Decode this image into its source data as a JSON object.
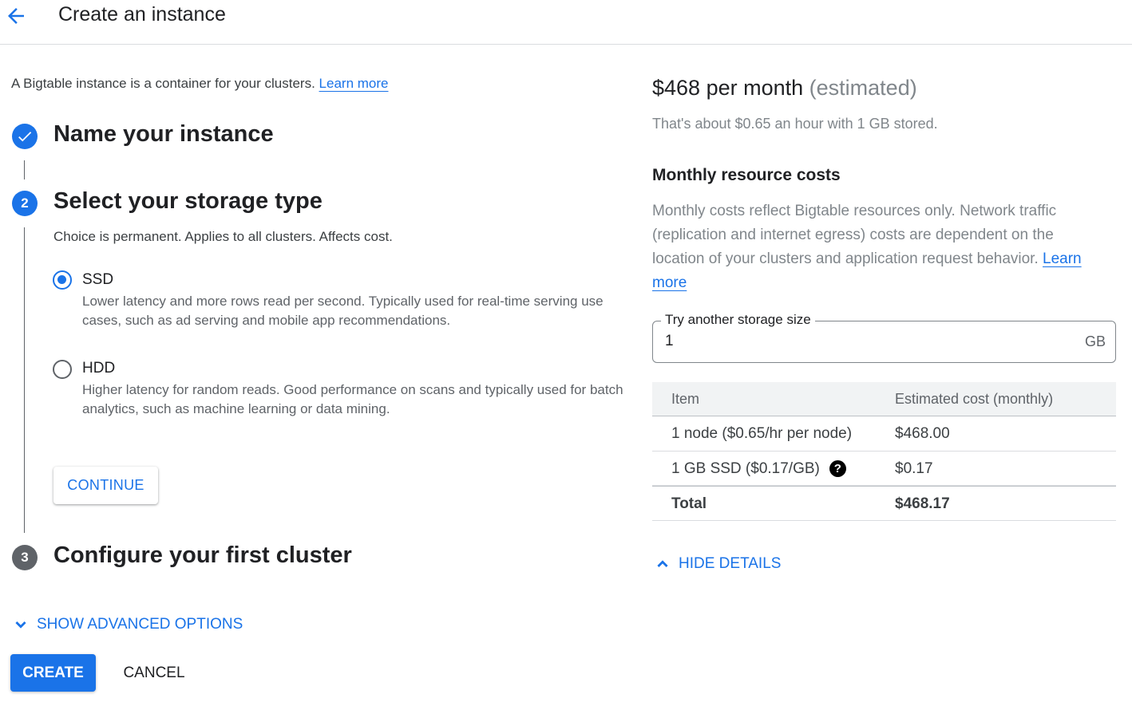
{
  "header": {
    "back_icon": "arrow-back-icon",
    "title": "Create an instance"
  },
  "intro": {
    "text": "A Bigtable instance is a container for your clusters.",
    "learn_more": "Learn more"
  },
  "steps": [
    {
      "number": "",
      "icon": "check-icon",
      "title": "Name your instance",
      "status": "done"
    },
    {
      "number": "2",
      "title": "Select your storage type",
      "status": "active",
      "description": "Choice is permanent. Applies to all clusters. Affects cost."
    },
    {
      "number": "3",
      "title": "Configure your first cluster",
      "status": "pending"
    }
  ],
  "storage_options": [
    {
      "label": "SSD",
      "selected": true,
      "description": "Lower latency and more rows read per second. Typically used for real-time serving use cases, such as ad serving and mobile app recommendations."
    },
    {
      "label": "HDD",
      "selected": false,
      "description": "Higher latency for random reads. Good performance on scans and typically used for batch analytics, such as machine learning or data mining."
    }
  ],
  "buttons": {
    "continue": "CONTINUE",
    "show_advanced": "SHOW ADVANCED OPTIONS",
    "create": "CREATE",
    "cancel": "CANCEL",
    "hide_details": "HIDE DETAILS"
  },
  "pricing": {
    "monthly": "$468 per month",
    "estimated": "(estimated)",
    "hourly_note": "That's about $0.65 an hour with 1 GB stored.",
    "costs_heading": "Monthly resource costs",
    "costs_description": "Monthly costs reflect Bigtable resources only. Network traffic (replication and internet egress) costs are dependent on the location of your clusters and application request behavior.",
    "learn_more": "Learn more",
    "storage_size": {
      "label": "Try another storage size",
      "value": "1",
      "unit": "GB"
    },
    "table": {
      "headers": [
        "Item",
        "Estimated cost (monthly)"
      ],
      "rows": [
        {
          "item": "1 node ($0.65/hr per node)",
          "cost": "$468.00",
          "help": false
        },
        {
          "item": "1 GB SSD ($0.17/GB)",
          "cost": "$0.17",
          "help": true
        },
        {
          "item": "Total",
          "cost": "$468.17",
          "total": true
        }
      ]
    }
  },
  "colors": {
    "accent": "#1a73e8",
    "text": "#202124",
    "muted": "#80868b",
    "pending_step": "#5f6368"
  }
}
